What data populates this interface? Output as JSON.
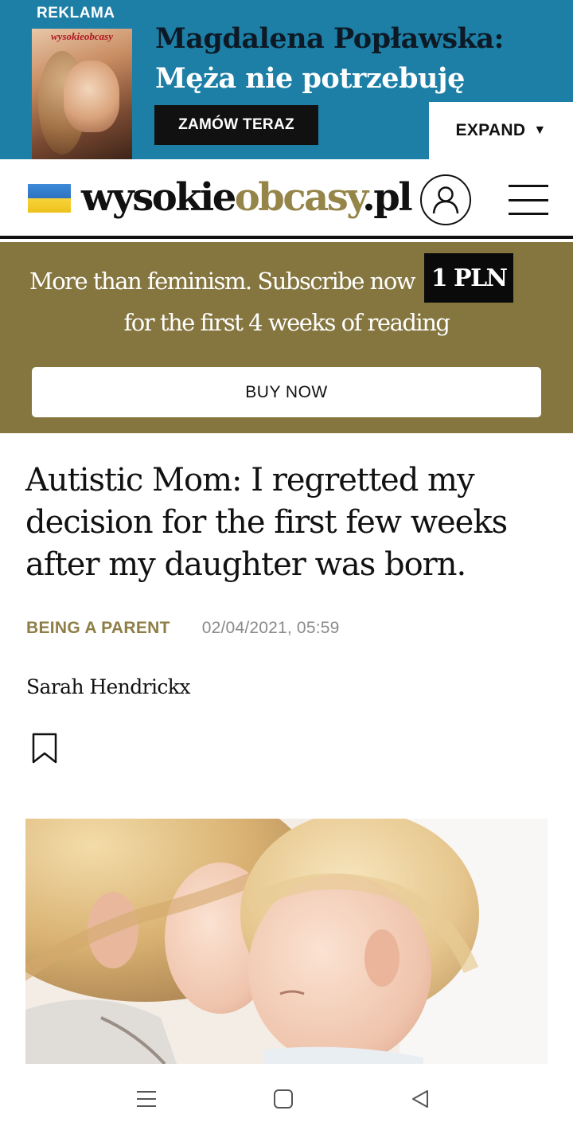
{
  "ad": {
    "label": "REKLAMA",
    "cover_title": "wysokieobcasy",
    "headline_line1": "Magdalena Popławska:",
    "headline_line2": "Męża nie potrzebuję",
    "cta_label": "ZAMÓW TERAZ",
    "expand_label": "EXPAND",
    "expand_icon": "triangle-down-icon",
    "bg_color": "#1d7fa6"
  },
  "header": {
    "flag_icon": "ukraine-flag-icon",
    "logo_part1": "wysokie",
    "logo_part2": "obcasy",
    "logo_part3": ".pl",
    "logo_accent_color": "#968549",
    "user_icon": "user-icon",
    "menu_icon": "hamburger-menu-icon"
  },
  "promo": {
    "line1": "More than feminism. Subscribe now",
    "price": "1 PLN",
    "line2": "for the first 4 weeks of reading",
    "button_label": "BUY NOW",
    "bg_color": "#857640"
  },
  "article": {
    "title": "Autistic Mom: I regretted my decision for the first few weeks after my daughter was born.",
    "category": "BEING A PARENT",
    "date": "02/04/2021, 05:59",
    "author": "Sarah Hendrickx",
    "bookmark_icon": "bookmark-icon"
  },
  "navbar": {
    "recent_icon": "recent-apps-icon",
    "home_icon": "home-square-icon",
    "back_icon": "back-triangle-icon"
  }
}
